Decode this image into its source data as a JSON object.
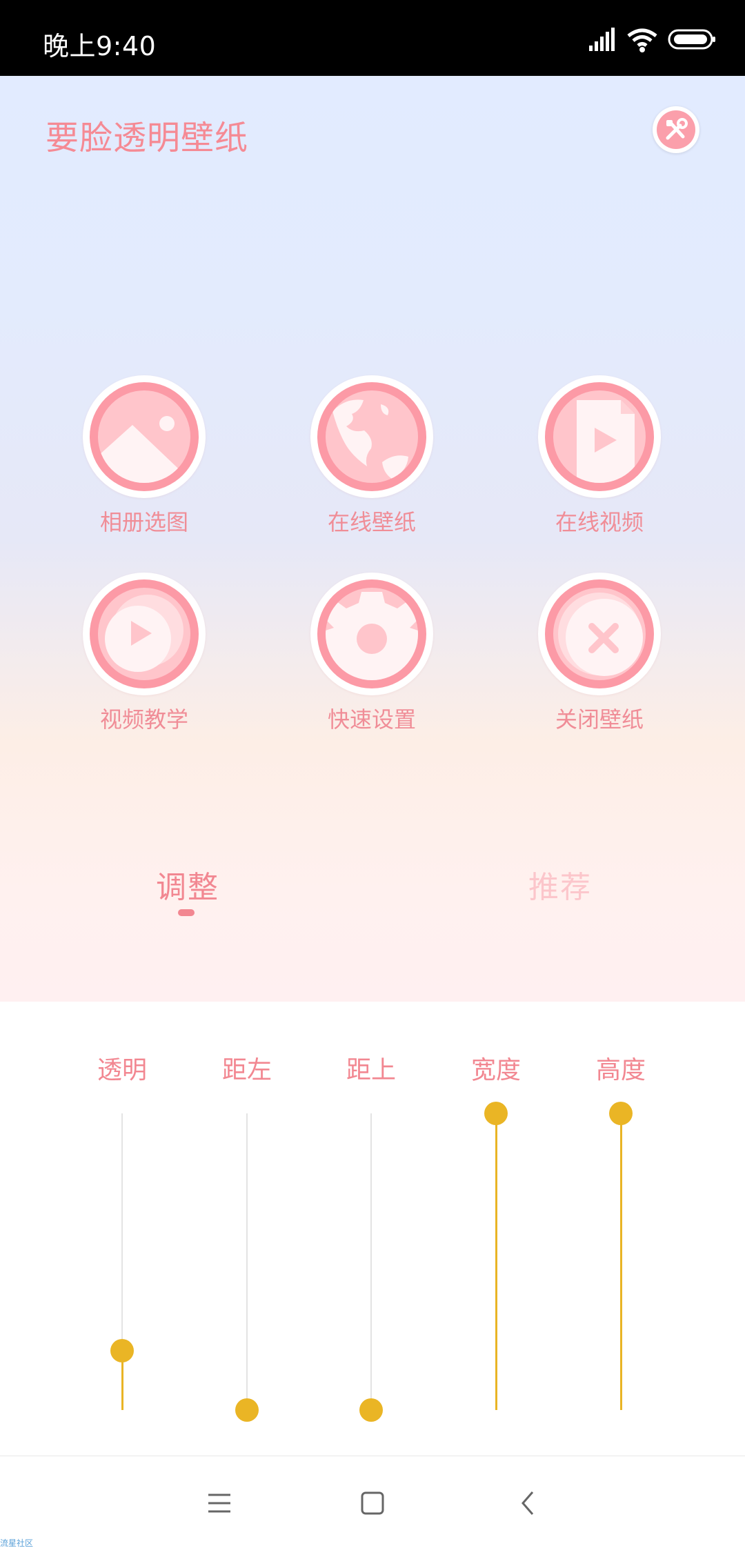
{
  "status_bar": {
    "time": "晚上9:40",
    "icons": [
      "signal-icon",
      "wifi-icon",
      "battery-icon"
    ]
  },
  "app": {
    "title": "要脸透明壁纸",
    "settings_icon": "tools-icon"
  },
  "menu": [
    {
      "label": "相册选图",
      "icon": "image-icon"
    },
    {
      "label": "在线壁纸",
      "icon": "globe-icon"
    },
    {
      "label": "在线视频",
      "icon": "video-file-icon"
    },
    {
      "label": "视频教学",
      "icon": "play-icon"
    },
    {
      "label": "快速设置",
      "icon": "gear-icon"
    },
    {
      "label": "关闭壁纸",
      "icon": "close-icon"
    }
  ],
  "tabs": [
    {
      "label": "调整",
      "active": true
    },
    {
      "label": "推荐",
      "active": false
    }
  ],
  "sliders": [
    {
      "label": "透明",
      "value": 0.2
    },
    {
      "label": "距左",
      "value": 0.0
    },
    {
      "label": "距上",
      "value": 0.0
    },
    {
      "label": "宽度",
      "value": 1.0
    },
    {
      "label": "高度",
      "value": 1.0
    }
  ],
  "nav": {
    "buttons": [
      "menu-icon",
      "home-icon",
      "back-icon"
    ]
  },
  "watermark": "流星社区",
  "colors": {
    "accent_pink": "#f28791",
    "icon_pink": "#fc9aa6",
    "slider_yellow": "#eab525"
  }
}
